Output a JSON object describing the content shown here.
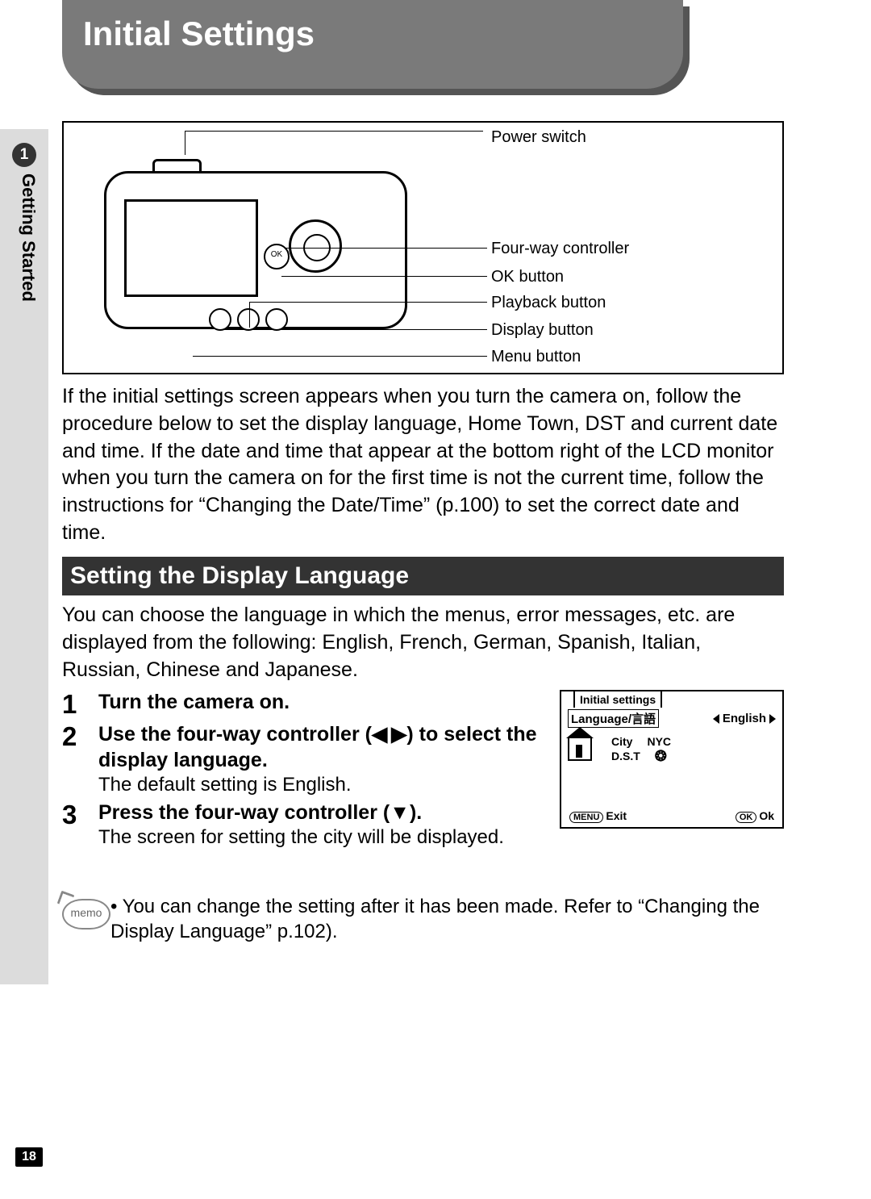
{
  "page_number": "18",
  "chapter_number": "1",
  "chapter_label": "Getting Started",
  "header_title": "Initial Settings",
  "diagram_labels": {
    "power_switch": "Power switch",
    "four_way": "Four-way controller",
    "ok_button": "OK button",
    "playback_button": "Playback button",
    "display_button": "Display button",
    "menu_button": "Menu button"
  },
  "intro_paragraph": "If the initial settings screen appears when you turn the camera on, follow the procedure below to set the display language, Home Town, DST and current date and time. If the date and time that appear at the bottom right of the LCD monitor when you turn the camera on for the first time is not the current time, follow the instructions for “Changing the Date/Time” (p.100) to set the correct date and time.",
  "section_title": "Setting the Display Language",
  "section_intro": "You can choose the language in which the menus, error messages, etc. are displayed from the following: English, French, German, Spanish, Italian, Russian, Chinese and Japanese.",
  "steps": [
    {
      "num": "1",
      "head": "Turn the camera on.",
      "body": ""
    },
    {
      "num": "2",
      "head": "Use the four-way controller (◀ ▶) to select the display language.",
      "body": "The default setting is English."
    },
    {
      "num": "3",
      "head": "Press the four-way controller (▼).",
      "body": "The screen for setting the city will be displayed."
    }
  ],
  "lcd": {
    "tab": "Initial settings",
    "language_label": "Language/言語",
    "language_value": "English",
    "city_label": "City",
    "city_value": "NYC",
    "dst_label": "D.S.T",
    "exit_pill": "MENU",
    "exit_label": "Exit",
    "ok_pill": "OK",
    "ok_label": "Ok"
  },
  "memo": {
    "icon_text": "memo",
    "text": "• You can change the setting after it has been made. Refer to “Changing the Display Language” p.102)."
  }
}
